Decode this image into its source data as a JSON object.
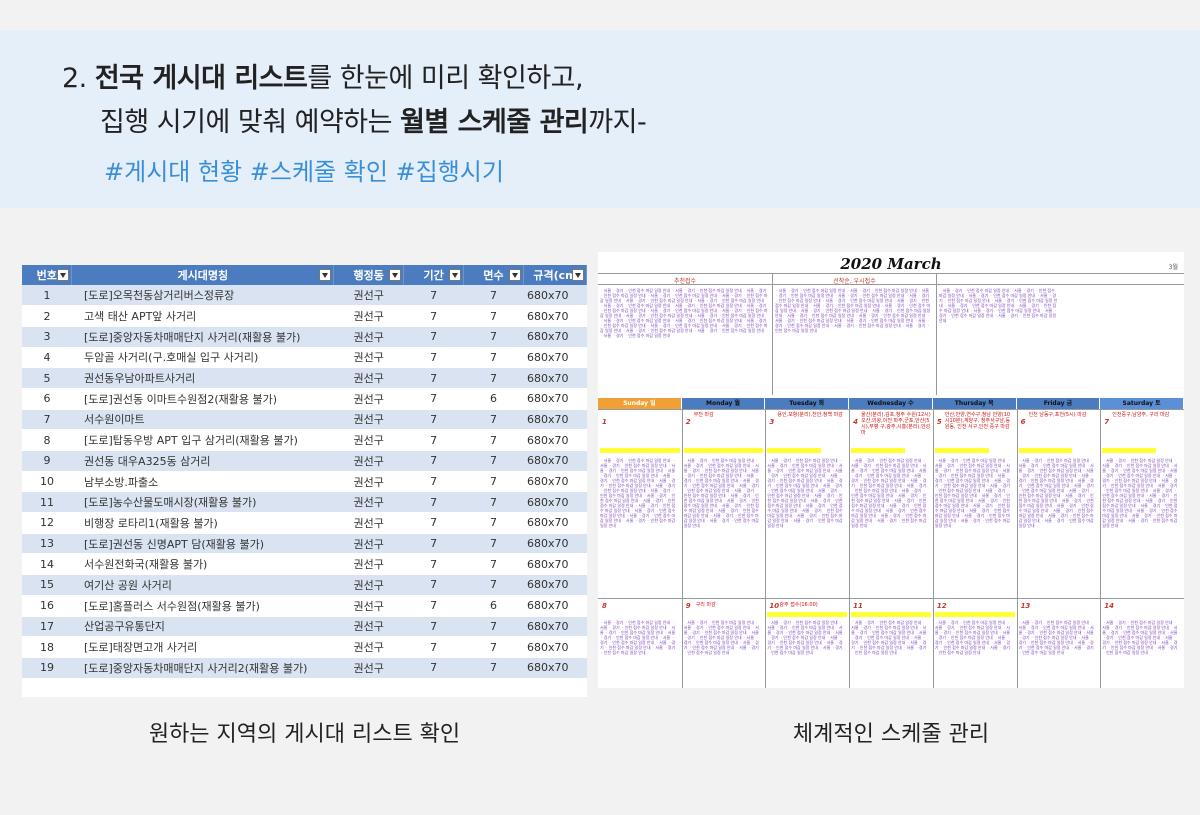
{
  "header": {
    "line1_prefix": "2. ",
    "line1_bold": "전국 게시대 리스트",
    "line1_rest": "를 한눈에 미리 확인하고,",
    "line2_prefix": "집행 시기에 맞춰 예약하는 ",
    "line2_bold": "월별 스케줄 관리",
    "line2_rest": "까지-",
    "tags": "#게시대 현황 #스케줄 확인 #집행시기"
  },
  "table": {
    "columns": [
      "번호",
      "게시대명칭",
      "행정동",
      "기간",
      "면수",
      "규격(cm"
    ],
    "rows": [
      [
        "1",
        "[도로]오목천동삼거리버스정류장",
        "권선구",
        "7",
        "7",
        "680x70"
      ],
      [
        "2",
        "고색 태산 APT앞 사거리",
        "권선구",
        "7",
        "7",
        "680x70"
      ],
      [
        "3",
        "[도로]중앙자동차매매단지 사거리(재활용 불가)",
        "권선구",
        "7",
        "7",
        "680x70"
      ],
      [
        "4",
        "두암골 사거리(구.호매실 입구 사거리)",
        "권선구",
        "7",
        "7",
        "680x70"
      ],
      [
        "5",
        "권선동우남아파트사거리",
        "권선구",
        "7",
        "7",
        "680x70"
      ],
      [
        "6",
        "[도로]권선동 이마트수원점2(재활용 불가)",
        "권선구",
        "7",
        "6",
        "680x70"
      ],
      [
        "7",
        "서수원이마트",
        "권선구",
        "7",
        "7",
        "680x70"
      ],
      [
        "8",
        "[도로]탑동우방 APT 입구 삼거리(재활용 불가)",
        "권선구",
        "7",
        "7",
        "680x70"
      ],
      [
        "9",
        "권선동 대우A325동 삼거리",
        "권선구",
        "7",
        "7",
        "680x70"
      ],
      [
        "10",
        "남부소방.파출소",
        "권선구",
        "7",
        "7",
        "680x70"
      ],
      [
        "11",
        "[도로]농수산물도매시장(재활용 불가)",
        "권선구",
        "7",
        "7",
        "680x70"
      ],
      [
        "12",
        "비행장 로타리1(재활용 불가)",
        "권선구",
        "7",
        "7",
        "680x70"
      ],
      [
        "13",
        "[도로]권선동 신명APT 담(재활용 불가)",
        "권선구",
        "7",
        "7",
        "680x70"
      ],
      [
        "14",
        "서수원전화국(재활용 불가)",
        "권선구",
        "7",
        "7",
        "680x70"
      ],
      [
        "15",
        "여기산 공원 사거리",
        "권선구",
        "7",
        "7",
        "680x70"
      ],
      [
        "16",
        "[도로]홈플러스 서수원점(재활용 불가)",
        "권선구",
        "7",
        "6",
        "680x70"
      ],
      [
        "17",
        "산업공구유통단지",
        "권선구",
        "7",
        "7",
        "680x70"
      ],
      [
        "18",
        "[도로]태장면고개 사거리",
        "권선구",
        "7",
        "7",
        "680x70"
      ],
      [
        "19",
        "[도로]중앙자동차매매단지 사거리2(재활용 불가)",
        "권선구",
        "7",
        "7",
        "680x70"
      ]
    ]
  },
  "calendar": {
    "title": "2020 March",
    "month_label": "3월",
    "col_headers": [
      "추천접수",
      "선착순, 우시접수",
      ""
    ],
    "days": [
      "Sunday 일",
      "Monday 월",
      "Tuesday 화",
      "Wednesday 수",
      "Thursday 목",
      "Friday 금",
      "Saturday 토"
    ],
    "day_colors": [
      "#f0a035",
      "#4a7cbf",
      "#4a7cbf",
      "#4a7cbf",
      "#4a7cbf",
      "#4a7cbf",
      "#5b8fd8"
    ],
    "week1_dates": [
      "1",
      "2",
      "3",
      "4",
      "5",
      "6",
      "7"
    ],
    "week2_dates": [
      "8",
      "9",
      "10",
      "11",
      "12",
      "13",
      "14"
    ],
    "week1_notes": [
      "",
      "부천 마감",
      "용인,포항(분리),천안,청백 마감",
      "울산(분리),김포,청주 수원(12시)오산,의왕,이천 파주,군포,안산(5시),부평 구,광주,시흥(분리),안성 마",
      "안산,안양,연수구,청남 안양(10시10분),계양구, 청주서구남,등원동, 인천 서구,인천 중구 마감",
      "인천 남동구,포천(5시) 마감",
      "인천중구,남양주, 구리 마감"
    ],
    "week2_notes": [
      "",
      "구리 마감",
      "광주 접수(16:00)",
      "",
      "",
      "",
      ""
    ]
  },
  "captions": {
    "left": "원하는 지역의 게시대 리스트 확인",
    "right": "체계적인 스케줄 관리"
  }
}
